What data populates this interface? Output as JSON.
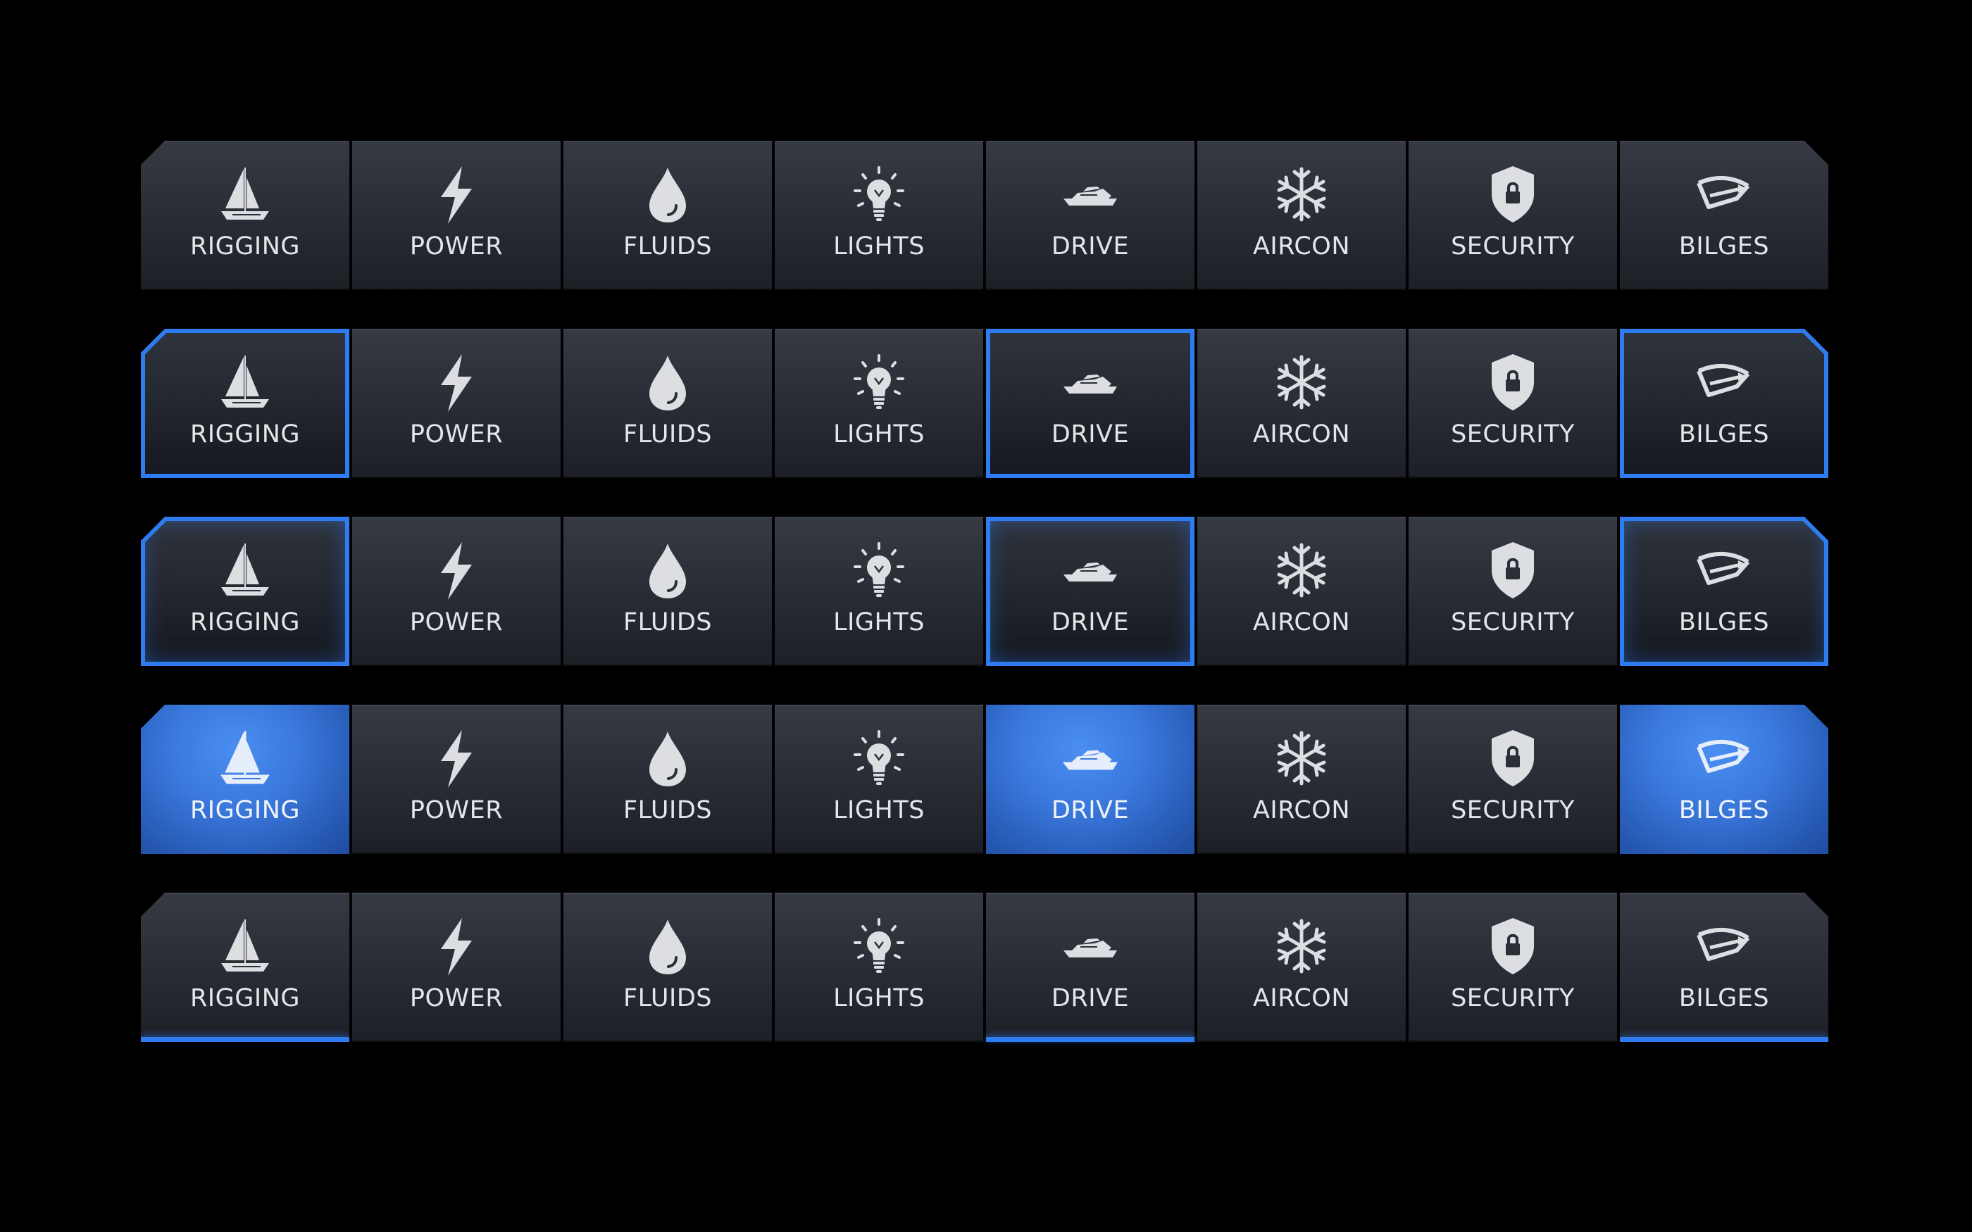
{
  "colors": {
    "background": "#000000",
    "button_top": "#363a43",
    "button_bottom": "#1c1f26",
    "label": "#e3e5e8",
    "icon": "#dcdee2",
    "accent": "#2f7cf0",
    "accent_fill": "#3a78dc"
  },
  "items": [
    {
      "label": "RIGGING",
      "icon": "sailboat-icon"
    },
    {
      "label": "POWER",
      "icon": "lightning-icon"
    },
    {
      "label": "FLUIDS",
      "icon": "droplet-icon"
    },
    {
      "label": "LIGHTS",
      "icon": "lightbulb-icon"
    },
    {
      "label": "DRIVE",
      "icon": "motorboat-icon"
    },
    {
      "label": "AIRCON",
      "icon": "snowflake-icon"
    },
    {
      "label": "SECURITY",
      "icon": "shield-lock-icon"
    },
    {
      "label": "BILGES",
      "icon": "bilge-icon"
    }
  ],
  "rows": [
    {
      "state": "default",
      "active_indices": []
    },
    {
      "state": "outline",
      "active_indices": [
        0,
        4,
        7
      ]
    },
    {
      "state": "glow",
      "active_indices": [
        0,
        4,
        7
      ]
    },
    {
      "state": "fill",
      "active_indices": [
        0,
        4,
        7
      ]
    },
    {
      "state": "underline",
      "active_indices": [
        0,
        4,
        7
      ]
    }
  ]
}
